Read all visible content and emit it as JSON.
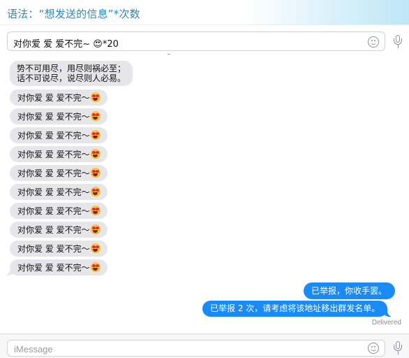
{
  "banner": {
    "title": "语法：“想发送的信息”*次数"
  },
  "compose_top": {
    "value": "对你爱 爱 爱不完~ 😍*20"
  },
  "messages": {
    "first": {
      "line1": "势不可用尽，用尽则祸必至；",
      "line2": "话不可说尽，说尽则人必易。"
    },
    "repeated": [
      "对你爱 爱 爱不完～",
      "对你爱 爱 爱不完～",
      "对你爱 爱 爱不完～",
      "对你爱 爱 爱不完～",
      "对你爱 爱 爱不完～",
      "对你爱 爱 爱不完～",
      "对你爱 爱 爱不完～",
      "对你爱 爱 爱不完～",
      "对你爱 爱 爱不完～",
      "对你爱 爱 爱不完～"
    ],
    "outgoing": [
      "已举报，你收手罢。",
      "已举报 2 次，请考虑将该地址移出群发名单。"
    ],
    "status": "Delivered"
  },
  "compose_bottom": {
    "placeholder": "iMessage"
  },
  "icons": {
    "emoji": "emoji-icon",
    "mic": "microphone-icon",
    "heart_eyes": "heart-eyes-emoji"
  },
  "colors": {
    "outgoing_bubble": "#1a8af5",
    "incoming_bubble": "#e5e5ea",
    "banner_text": "#2a89b9"
  }
}
